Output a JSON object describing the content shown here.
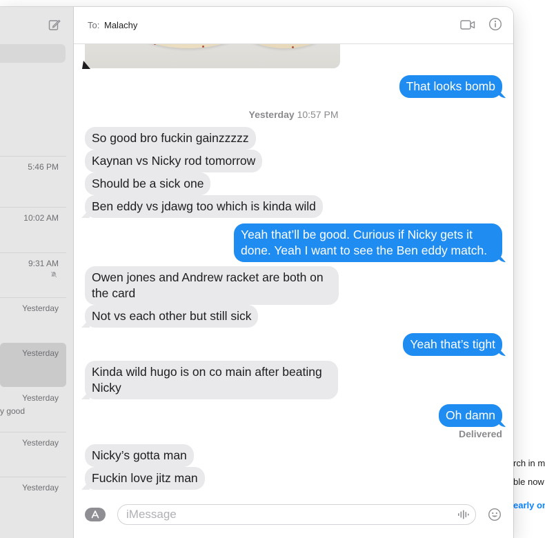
{
  "background_page": {
    "line1": "rch in m",
    "line2": "ble now f",
    "line3": "early on"
  },
  "sidebar": {
    "conversations": [
      {
        "time": "5:46 PM",
        "snippet": ""
      },
      {
        "time": "10:02 AM",
        "snippet": ""
      },
      {
        "time": "9:31 AM",
        "snippet": "",
        "muted": true
      },
      {
        "time": "Yesterday",
        "snippet": ""
      },
      {
        "time": "Yesterday",
        "snippet": "",
        "selected": true
      },
      {
        "time": "Yesterday",
        "snippet": "y good"
      },
      {
        "time": "Yesterday",
        "snippet": ""
      },
      {
        "time": "Yesterday",
        "snippet": ""
      }
    ]
  },
  "header": {
    "to_label": "To:",
    "recipient": "Malachy"
  },
  "messages": {
    "m1": "That looks bomb",
    "timestamp_day": "Yesterday",
    "timestamp_time": "10:57 PM",
    "m2": "So good bro fuckin gainzzzzz",
    "m3": "Kaynan vs Nicky rod tomorrow",
    "m4": "Should be a sick one",
    "m5": "Ben eddy vs jdawg too which is kinda wild",
    "m6": "Yeah that’ll be good. Curious if Nicky gets it done. Yeah I want to see the Ben eddy match.",
    "m7": "Owen jones and Andrew racket are both on the card",
    "m8": "Not vs each other but still sick",
    "m9": "Yeah that’s tight",
    "m10": "Kinda wild hugo is on co main after beating Nicky",
    "m11": "Oh damn",
    "delivered": "Delivered",
    "m12": "Nicky’s gotta man",
    "m13": "Fuckin love jitz man"
  },
  "input": {
    "placeholder": "iMessage"
  },
  "colors": {
    "outgoing_bubble": "#1e8cf0",
    "incoming_bubble": "#e9e9eb",
    "sidebar_bg": "#e6e6e6"
  }
}
